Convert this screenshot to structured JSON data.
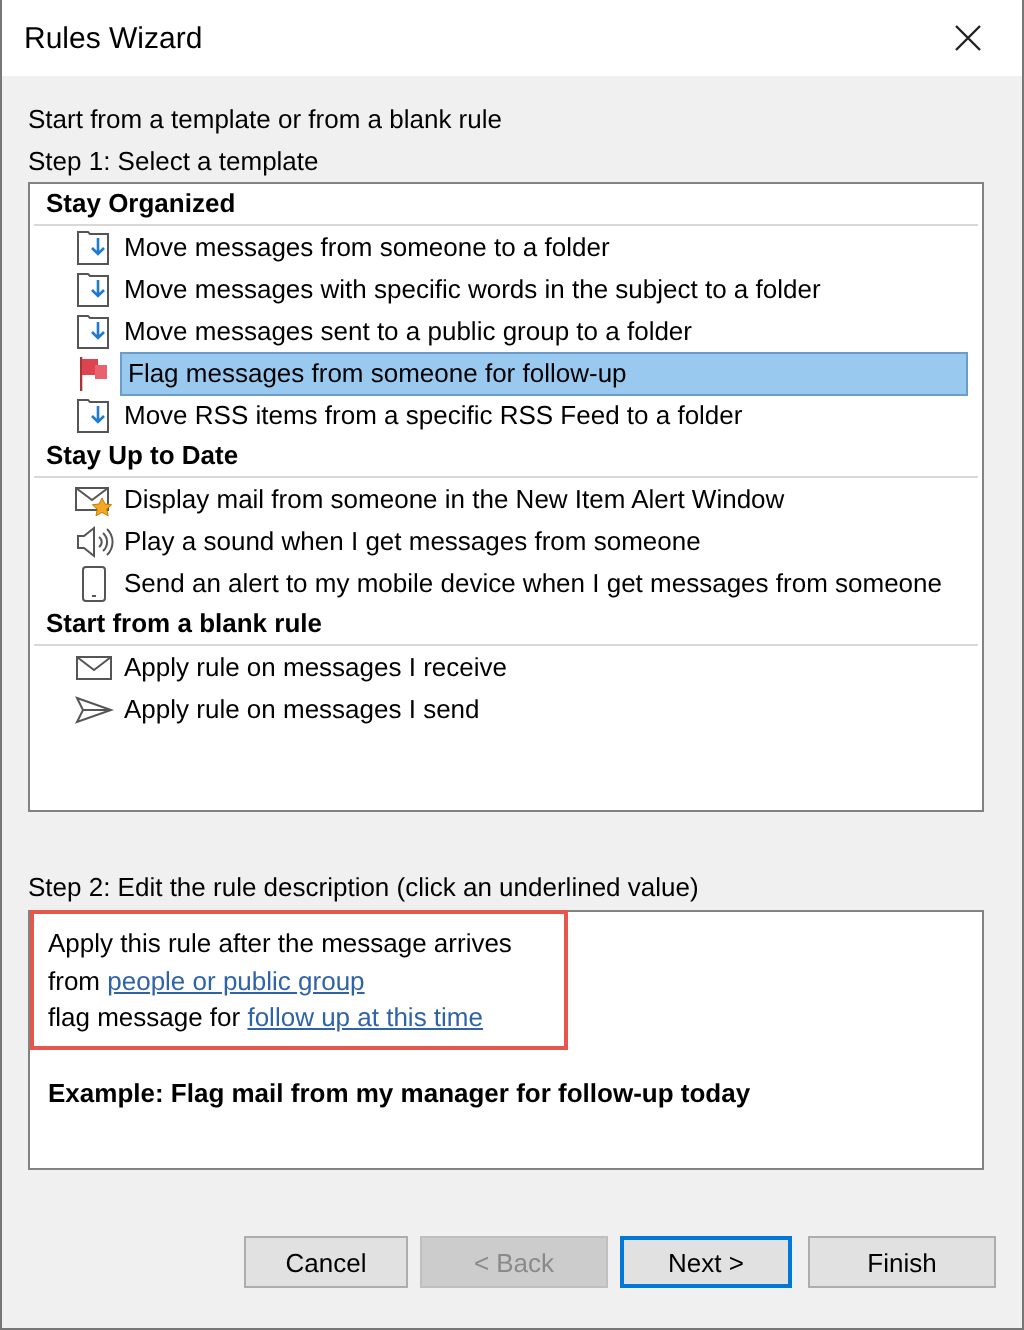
{
  "window": {
    "title": "Rules Wizard"
  },
  "intro": "Start from a template or from a blank rule",
  "step1": {
    "label": "Step 1: Select a template",
    "groups": [
      {
        "title": "Stay Organized",
        "items": [
          {
            "label": "Move messages from someone to a folder",
            "kind": "move",
            "selected": false
          },
          {
            "label": "Move messages with specific words in the subject to a folder",
            "kind": "move",
            "selected": false
          },
          {
            "label": "Move messages sent to a public group to a folder",
            "kind": "move",
            "selected": false
          },
          {
            "label": "Flag messages from someone for follow-up",
            "kind": "flag",
            "selected": true
          },
          {
            "label": "Move RSS items from a specific RSS Feed to a folder",
            "kind": "move",
            "selected": false
          }
        ]
      },
      {
        "title": "Stay Up to Date",
        "items": [
          {
            "label": "Display mail from someone in the New Item Alert Window",
            "kind": "alert",
            "selected": false
          },
          {
            "label": "Play a sound when I get messages from someone",
            "kind": "sound",
            "selected": false
          },
          {
            "label": "Send an alert to my mobile device when I get messages from someone",
            "kind": "mobile",
            "selected": false
          }
        ]
      },
      {
        "title": "Start from a blank rule",
        "items": [
          {
            "label": "Apply rule on messages I receive",
            "kind": "envelope",
            "selected": false
          },
          {
            "label": "Apply rule on messages I send",
            "kind": "send",
            "selected": false
          }
        ]
      }
    ]
  },
  "step2": {
    "label": "Step 2: Edit the rule description (click an underlined value)",
    "highlighted": true,
    "lines": [
      {
        "text": "Apply this rule after the message arrives"
      },
      {
        "text": "from ",
        "link": "people or public group"
      },
      {
        "text": "flag message for ",
        "link": "follow up at this time"
      }
    ],
    "example": "Example: Flag mail from my manager for follow-up today"
  },
  "buttons": [
    {
      "label": "Cancel",
      "disabled": false,
      "default": false
    },
    {
      "label": "< Back",
      "disabled": true,
      "default": false
    },
    {
      "label": "Next >",
      "disabled": false,
      "default": true
    },
    {
      "label": "Finish",
      "disabled": false,
      "default": false
    }
  ]
}
